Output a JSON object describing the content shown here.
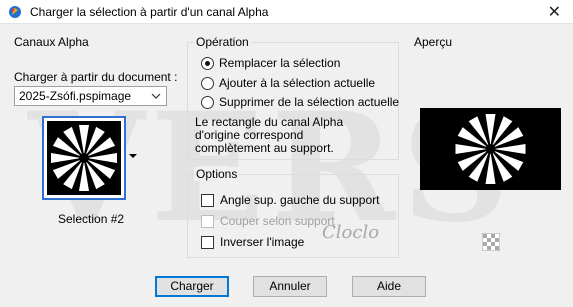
{
  "window": {
    "title": "Charger la sélection à partir d'un canal Alpha",
    "close_glyph": "✕"
  },
  "watermark": "VERS",
  "left_panel": {
    "heading": "Canaux Alpha",
    "doc_label": "Charger à partir du document :",
    "doc_selected": "2025-Zsófi.pspimage",
    "selection_name": "Selection #2"
  },
  "operation": {
    "title": "Opération",
    "options": [
      {
        "label": "Remplacer la sélection",
        "selected": true
      },
      {
        "label": "Ajouter à la sélection actuelle",
        "selected": false
      },
      {
        "label": "Supprimer de la sélection actuelle",
        "selected": false
      }
    ],
    "info_lines": [
      "Le rectangle du canal Alpha",
      "d'origine correspond",
      "complètement au support."
    ]
  },
  "options": {
    "title": "Options",
    "items": [
      {
        "label": "Angle sup. gauche du support",
        "checked": false,
        "disabled": false
      },
      {
        "label": "Couper selon support",
        "checked": false,
        "disabled": true
      },
      {
        "label": "Inverser l'image",
        "checked": false,
        "disabled": false
      }
    ]
  },
  "preview": {
    "title": "Aperçu"
  },
  "signature": "Cloclo",
  "buttons": {
    "load": "Charger",
    "cancel": "Annuler",
    "help": "Aide"
  }
}
